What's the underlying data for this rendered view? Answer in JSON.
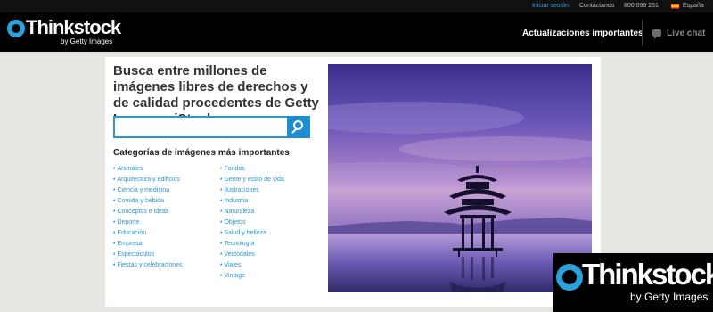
{
  "topbar": {
    "signin": "Iniciar sesión",
    "contact": "Contáctanos",
    "phone": "800 099 251",
    "country": "España"
  },
  "brand": {
    "name": "Thinkstock",
    "sub": "by Getty Images",
    "accent": "#2aa2dc"
  },
  "header": {
    "updates_link": "Actualizaciones importantes",
    "live_chat": "Live chat"
  },
  "main": {
    "headline": "Busca entre millones de imágenes libres de derechos y de calidad procedentes de Getty Images y iStock",
    "search": {
      "value": "",
      "placeholder": ""
    },
    "categories_title": "Categorías de imágenes más importantes",
    "categories_col1": [
      "Animales",
      "Arquitectura y edificios",
      "Ciencia y medicina",
      "Comida y bebida",
      "Conceptos e ideas",
      "Deporte",
      "Educación",
      "Empresa",
      "Espectáculos",
      "Fiestas y celebraciones"
    ],
    "categories_col2": [
      "Fondos",
      "Gente y estilo de vida",
      "Ilustraciones",
      "Industria",
      "Naturaleza",
      "Objetos",
      "Salud y belleza",
      "Tecnología",
      "Vectoriales",
      "Viajes",
      "Vintage"
    ]
  },
  "watermark": {
    "name": "Thinkstock",
    "sub": "by Getty Images"
  },
  "colors": {
    "link": "#2a96d6",
    "header_bg": "#000000",
    "page_bg": "#e6e5e0"
  }
}
